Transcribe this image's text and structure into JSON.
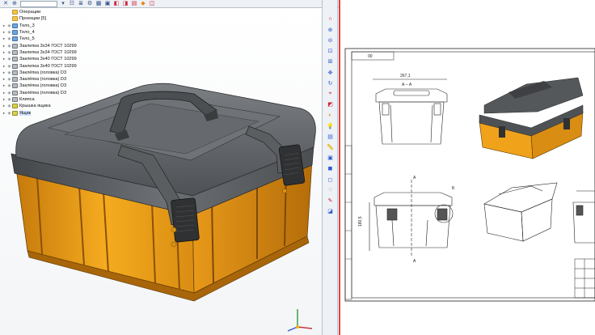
{
  "tree": {
    "items": [
      {
        "label": "Операции",
        "icon": "folder",
        "caret": "",
        "eye": false
      },
      {
        "label": "Проекции [5]",
        "icon": "folder",
        "caret": "",
        "eye": false
      },
      {
        "label": "Тело_3",
        "icon": "body",
        "caret": "+",
        "eye": true
      },
      {
        "label": "Тело_4",
        "icon": "body",
        "caret": "+",
        "eye": true
      },
      {
        "label": "Тело_5",
        "icon": "body",
        "caret": "+",
        "eye": true
      },
      {
        "label": "Заклепка 3х34 ГОСТ 10299",
        "icon": "rivet",
        "caret": "+",
        "eye": true
      },
      {
        "label": "Заклепка 3х34 ГОСТ 10299",
        "icon": "rivet",
        "caret": "+",
        "eye": true
      },
      {
        "label": "Заклепка 3х40 ГОСТ 10299",
        "icon": "rivet",
        "caret": "+",
        "eye": true
      },
      {
        "label": "Заклепка 3х40 ГОСТ 10299",
        "icon": "rivet",
        "caret": "+",
        "eye": true
      },
      {
        "label": "Заклёпка (головка) D3",
        "icon": "rivet",
        "caret": "+",
        "eye": true
      },
      {
        "label": "Заклёпка (головка) D3",
        "icon": "rivet",
        "caret": "+",
        "eye": true
      },
      {
        "label": "Заклёпка (головка) D3",
        "icon": "rivet",
        "caret": "+",
        "eye": true
      },
      {
        "label": "Заклёпка (головка) D3",
        "icon": "rivet",
        "caret": "+",
        "eye": true
      },
      {
        "label": "Клипса",
        "icon": "rivet",
        "caret": "+",
        "eye": true
      },
      {
        "label": "Крышка ящика",
        "icon": "part",
        "caret": "+",
        "eye": true
      },
      {
        "label": "Ящик",
        "icon": "part",
        "caret": "+",
        "eye": true
      }
    ]
  },
  "drawing": {
    "stamp": "00",
    "dim_width": "267,1",
    "section_label": "А – А",
    "cut_a": "А",
    "cut_b": "Б",
    "dim_height": "180,5"
  },
  "colors": {
    "body_orange": "#f0a21a",
    "lid_dark": "#55585b",
    "divider": "#e0413d",
    "toolbar_bg": "#eef1f5"
  },
  "icons": {
    "top_toolbar": [
      "close-icon",
      "pin-icon",
      "combo-box",
      "filter-icon",
      "tree-icon",
      "list-icon",
      "settings-icon",
      "grid-icon",
      "select-icon",
      "part-icon",
      "rivet-icon",
      "assembly-icon",
      "orange-icon",
      "view-icon"
    ],
    "side_toolbar": [
      "magnet-icon",
      "zoom-in-icon",
      "zoom-out-icon",
      "zoom-window-icon",
      "zoom-fit-icon",
      "pan-icon",
      "rotate-icon",
      "orient-icon",
      "section-icon",
      "color-icon",
      "lamp-icon",
      "layer-icon",
      "measure-icon",
      "display-icon",
      "shade-icon",
      "wire-icon",
      "hidden-icon",
      "edit-icon",
      "perspective-icon"
    ]
  }
}
